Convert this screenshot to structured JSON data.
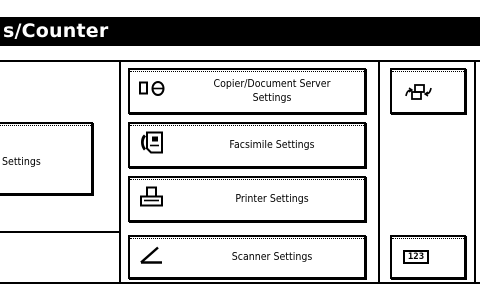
{
  "title": "s/Counter",
  "left_button_label": "Settings",
  "buttons": [
    {
      "label": "Copier/Document Server\nSettings",
      "icon": "copier-document-server-icon"
    },
    {
      "label": "Facsimile Settings",
      "icon": "facsimile-icon"
    },
    {
      "label": "Printer Settings",
      "icon": "printer-icon"
    },
    {
      "label": "Scanner Settings",
      "icon": "scanner-icon"
    }
  ],
  "side_icons": [
    "network-swap-icon",
    "counter-123-icon"
  ],
  "counter_text": "123"
}
